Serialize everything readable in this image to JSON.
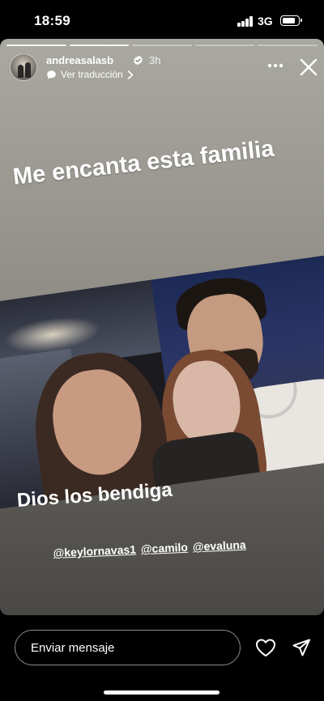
{
  "status_bar": {
    "time": "18:59",
    "network": "3G",
    "battery_level": 0.85
  },
  "story": {
    "progress": {
      "segments": 5,
      "completed": 2
    },
    "header": {
      "username": "andreasalasb",
      "verified_icon": "verified-badge-icon",
      "time_ago": "3h",
      "translate_label": "Ver traducción"
    },
    "caption_top": "Me encanta esta familia",
    "caption_bottom": "Dios los bendiga",
    "mentions": [
      "@keylornavas1",
      "@camilo",
      "@evaluna"
    ]
  },
  "footer": {
    "message_placeholder": "Enviar mensaje",
    "like_icon": "heart-icon",
    "share_icon": "send-icon"
  },
  "colors": {
    "background": "#000000",
    "text": "#ffffff"
  }
}
